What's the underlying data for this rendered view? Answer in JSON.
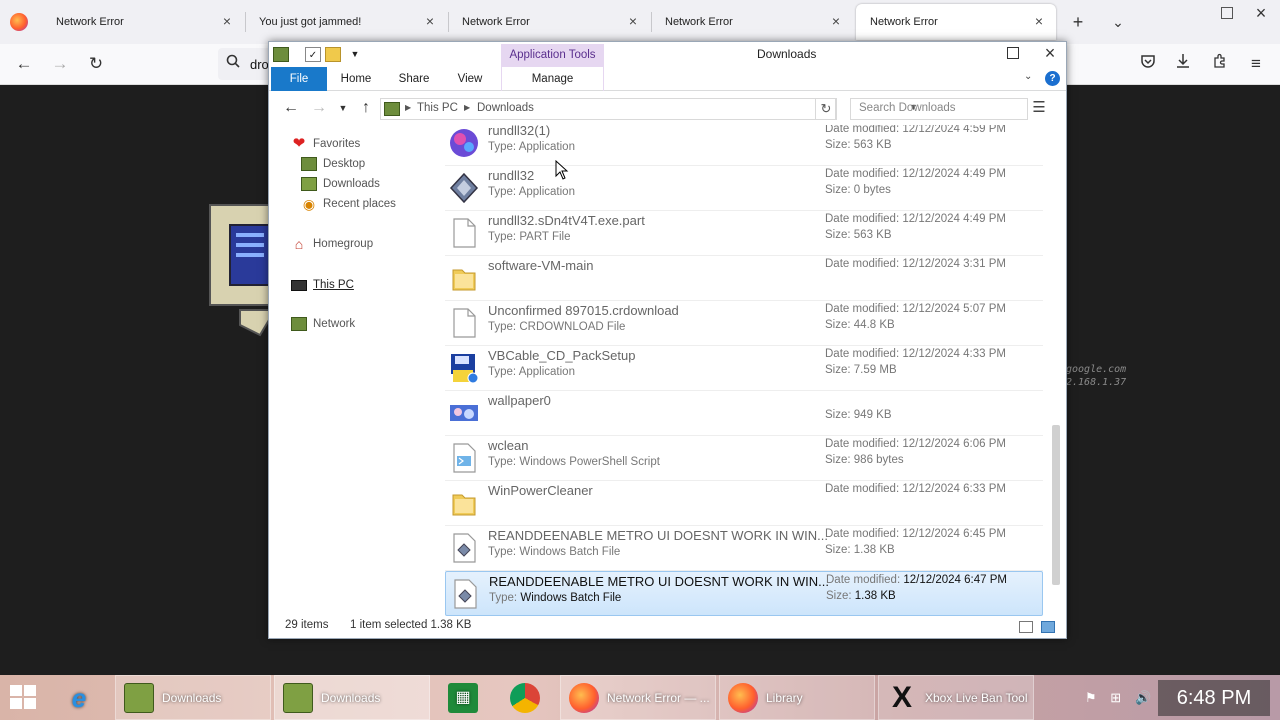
{
  "browser": {
    "tabs": [
      {
        "title": "Network Error"
      },
      {
        "title": "You just got jammed!"
      },
      {
        "title": "Network Error"
      },
      {
        "title": "Network Error"
      },
      {
        "title": "Network Error"
      }
    ],
    "new_tab": "+",
    "tab_list": "⌄",
    "url_partial": "dro",
    "icons": [
      "back-icon",
      "forward-icon",
      "reload-icon",
      "pocket-icon",
      "downloads-icon",
      "extensions-icon",
      "menu-icon"
    ]
  },
  "page": {
    "side_text_1": "google.com",
    "side_text_2": "2.168.1.37"
  },
  "explorer": {
    "title": "Downloads",
    "app_tools": "Application Tools",
    "ribbon": {
      "file": "File",
      "home": "Home",
      "share": "Share",
      "view": "View",
      "manage": "Manage"
    },
    "address": {
      "crumb1": "This PC",
      "crumb2": "Downloads"
    },
    "search_placeholder": "Search Downloads",
    "nav": {
      "favorites": "Favorites",
      "desktop": "Desktop",
      "downloads": "Downloads",
      "recent": "Recent places",
      "homegroup": "Homegroup",
      "thispc": "This PC",
      "network": "Network"
    },
    "labels": {
      "date_modified": "Date modified:",
      "size": "Size:",
      "type": "Type:"
    },
    "files": [
      {
        "name": "rundll32(1)",
        "type": "Application",
        "date": "12/12/2024 4:59 PM",
        "size": "563 KB"
      },
      {
        "name": "rundll32",
        "type": "Application",
        "date": "12/12/2024 4:49 PM",
        "size": "0 bytes"
      },
      {
        "name": "rundll32.sDn4tV4T.exe.part",
        "type": "PART File",
        "date": "12/12/2024 4:49 PM",
        "size": "563 KB"
      },
      {
        "name": "software-VM-main",
        "type": "",
        "date": "12/12/2024 3:31 PM",
        "size": ""
      },
      {
        "name": "Unconfirmed 897015.crdownload",
        "type": "CRDOWNLOAD File",
        "date": "12/12/2024 5:07 PM",
        "size": "44.8 KB"
      },
      {
        "name": "VBCable_CD_PackSetup",
        "type": "Application",
        "date": "12/12/2024 4:33 PM",
        "size": "7.59 MB"
      },
      {
        "name": "wallpaper0",
        "type": "",
        "date": "",
        "size": "949 KB"
      },
      {
        "name": "wclean",
        "type": "Windows PowerShell Script",
        "date": "12/12/2024 6:06 PM",
        "size": "986 bytes"
      },
      {
        "name": "WinPowerCleaner",
        "type": "",
        "date": "12/12/2024 6:33 PM",
        "size": ""
      },
      {
        "name": "REANDDEENABLE METRO UI DOESNT WORK IN WIN...",
        "type": "Windows Batch File",
        "date": "12/12/2024 6:45 PM",
        "size": "1.38 KB"
      },
      {
        "name": "REANDDEENABLE METRO UI DOESNT WORK IN WIN...",
        "type": "Windows Batch File",
        "date": "12/12/2024 6:47 PM",
        "size": "1.38 KB"
      }
    ],
    "status": {
      "count": "29 items",
      "selected": "1 item selected  1.38 KB"
    }
  },
  "taskbar": {
    "items": [
      {
        "label": "Downloads"
      },
      {
        "label": "Downloads"
      },
      {
        "label": "Network Error — ..."
      },
      {
        "label": "Library"
      },
      {
        "label": "Xbox Live Ban Tool"
      }
    ],
    "clock": "6:48 PM"
  },
  "colors": {
    "ribbon_file": "#1979ca",
    "app_tools": "#e6d7f1",
    "selection": "#cde5fb"
  }
}
